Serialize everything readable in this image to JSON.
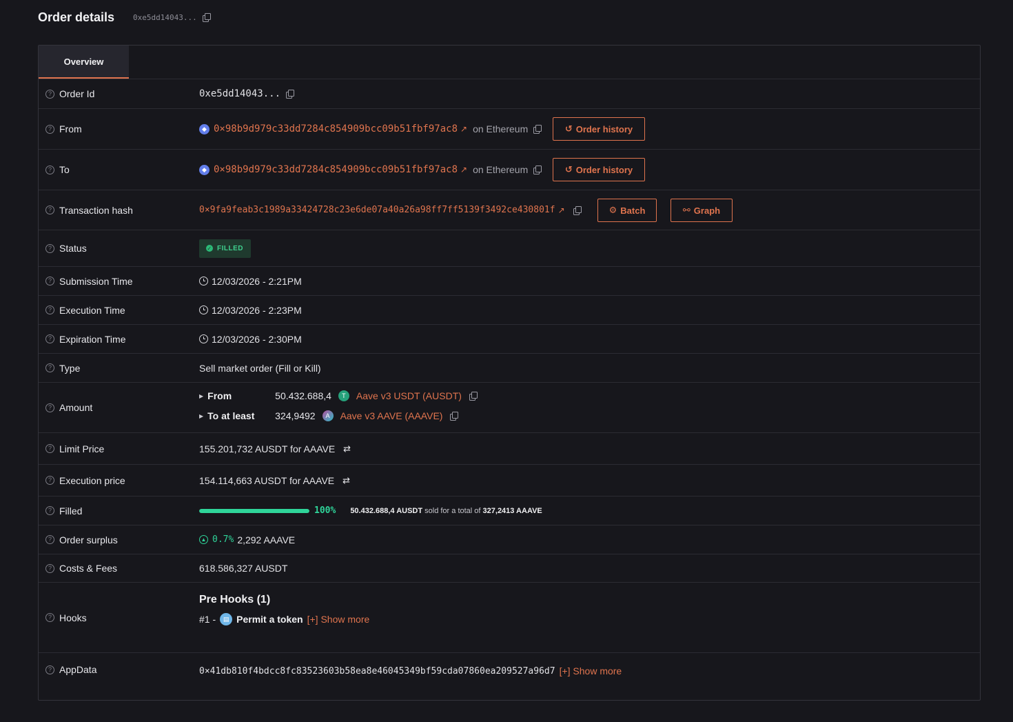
{
  "header": {
    "title": "Order details",
    "short_id": "0xe5dd14043..."
  },
  "tabs": [
    {
      "label": "Overview"
    }
  ],
  "rows": {
    "order_id": {
      "label": "Order Id",
      "value": "0xe5dd14043..."
    },
    "from": {
      "label": "From",
      "address": "0×98b9d979c33dd7284c854909bcc09b51fbf97ac8",
      "network": "on Ethereum",
      "button": "Order history"
    },
    "to": {
      "label": "To",
      "address": "0×98b9d979c33dd7284c854909bcc09b51fbf97ac8",
      "network": "on Ethereum",
      "button": "Order history"
    },
    "tx_hash": {
      "label": "Transaction hash",
      "value": "0×9fa9feab3c1989a33424728c23e6de07a40a26a98ff7ff5139f3492ce430801f",
      "batch_button": "Batch",
      "graph_button": "Graph"
    },
    "status": {
      "label": "Status",
      "value": "FILLED"
    },
    "submission_time": {
      "label": "Submission Time",
      "value": "12/03/2026 - 2:21PM"
    },
    "execution_time": {
      "label": "Execution Time",
      "value": "12/03/2026 - 2:23PM"
    },
    "expiration_time": {
      "label": "Expiration Time",
      "value": "12/03/2026 - 2:30PM"
    },
    "type": {
      "label": "Type",
      "value": "Sell market order (Fill or Kill)"
    },
    "amount": {
      "label": "Amount",
      "from_key": "From",
      "from_value": "50.432.688,4",
      "from_token": "Aave v3 USDT (AUSDT)",
      "to_key": "To at least",
      "to_value": "324,9492",
      "to_token": "Aave v3 AAVE (AAAVE)"
    },
    "limit_price": {
      "label": "Limit Price",
      "value": "155.201,732 AUSDT for AAAVE"
    },
    "execution_price": {
      "label": "Execution price",
      "value": "154.114,663 AUSDT for AAAVE"
    },
    "filled": {
      "label": "Filled",
      "percent": 100,
      "percent_label": "100%",
      "sold_amount": "50.432.688,4 AUSDT",
      "sold_for_text": "sold for a total of",
      "total": "327,2413 AAAVE"
    },
    "order_surplus": {
      "label": "Order surplus",
      "percent": "0.7%",
      "amount": "2,292 AAAVE"
    },
    "costs_fees": {
      "label": "Costs & Fees",
      "value": "618.586,327 AUSDT"
    },
    "hooks": {
      "label": "Hooks",
      "title": "Pre Hooks (1)",
      "index": "#1 -",
      "name": "Permit a token",
      "show_more": "[+] Show more"
    },
    "app_data": {
      "label": "AppData",
      "value": "0×41db810f4bdcc8fc83523603b58ea8e46045349bf59cda07860ea209527a96d7",
      "show_more": "[+] Show more"
    }
  },
  "colors": {
    "accent": "#e0744e",
    "success": "#2fd59a",
    "background": "#17171c",
    "border": "#2c2c33"
  }
}
